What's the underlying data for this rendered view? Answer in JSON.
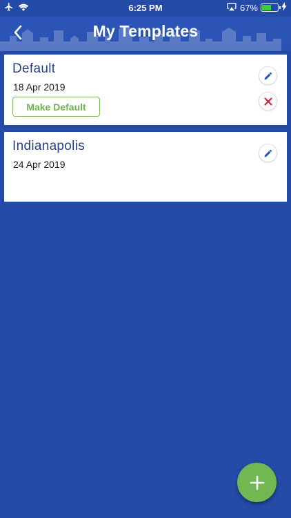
{
  "status_bar": {
    "time": "6:25 PM",
    "battery_percent": "67%",
    "battery_level": 0.67,
    "icons": [
      "airplane-icon",
      "wifi-icon",
      "screen-mirroring-icon",
      "battery-icon",
      "charging-bolt-icon"
    ]
  },
  "header": {
    "title": "My Templates",
    "back_icon": "chevron-left-icon"
  },
  "templates": [
    {
      "name": "Default",
      "date": "18 Apr 2019",
      "make_default_label": "Make Default",
      "actions": [
        "pencil-icon",
        "close-icon"
      ]
    },
    {
      "name": "Indianapolis",
      "date": "24 Apr 2019",
      "actions": [
        "pencil-icon"
      ]
    }
  ],
  "fab": {
    "icon": "plus-icon"
  },
  "colors": {
    "background": "#244ba8",
    "header": "#2a52b2",
    "title_text": "#263f8c",
    "accent_green": "#72b852",
    "edit_icon": "#2d55b5",
    "delete_icon": "#d0293a"
  }
}
